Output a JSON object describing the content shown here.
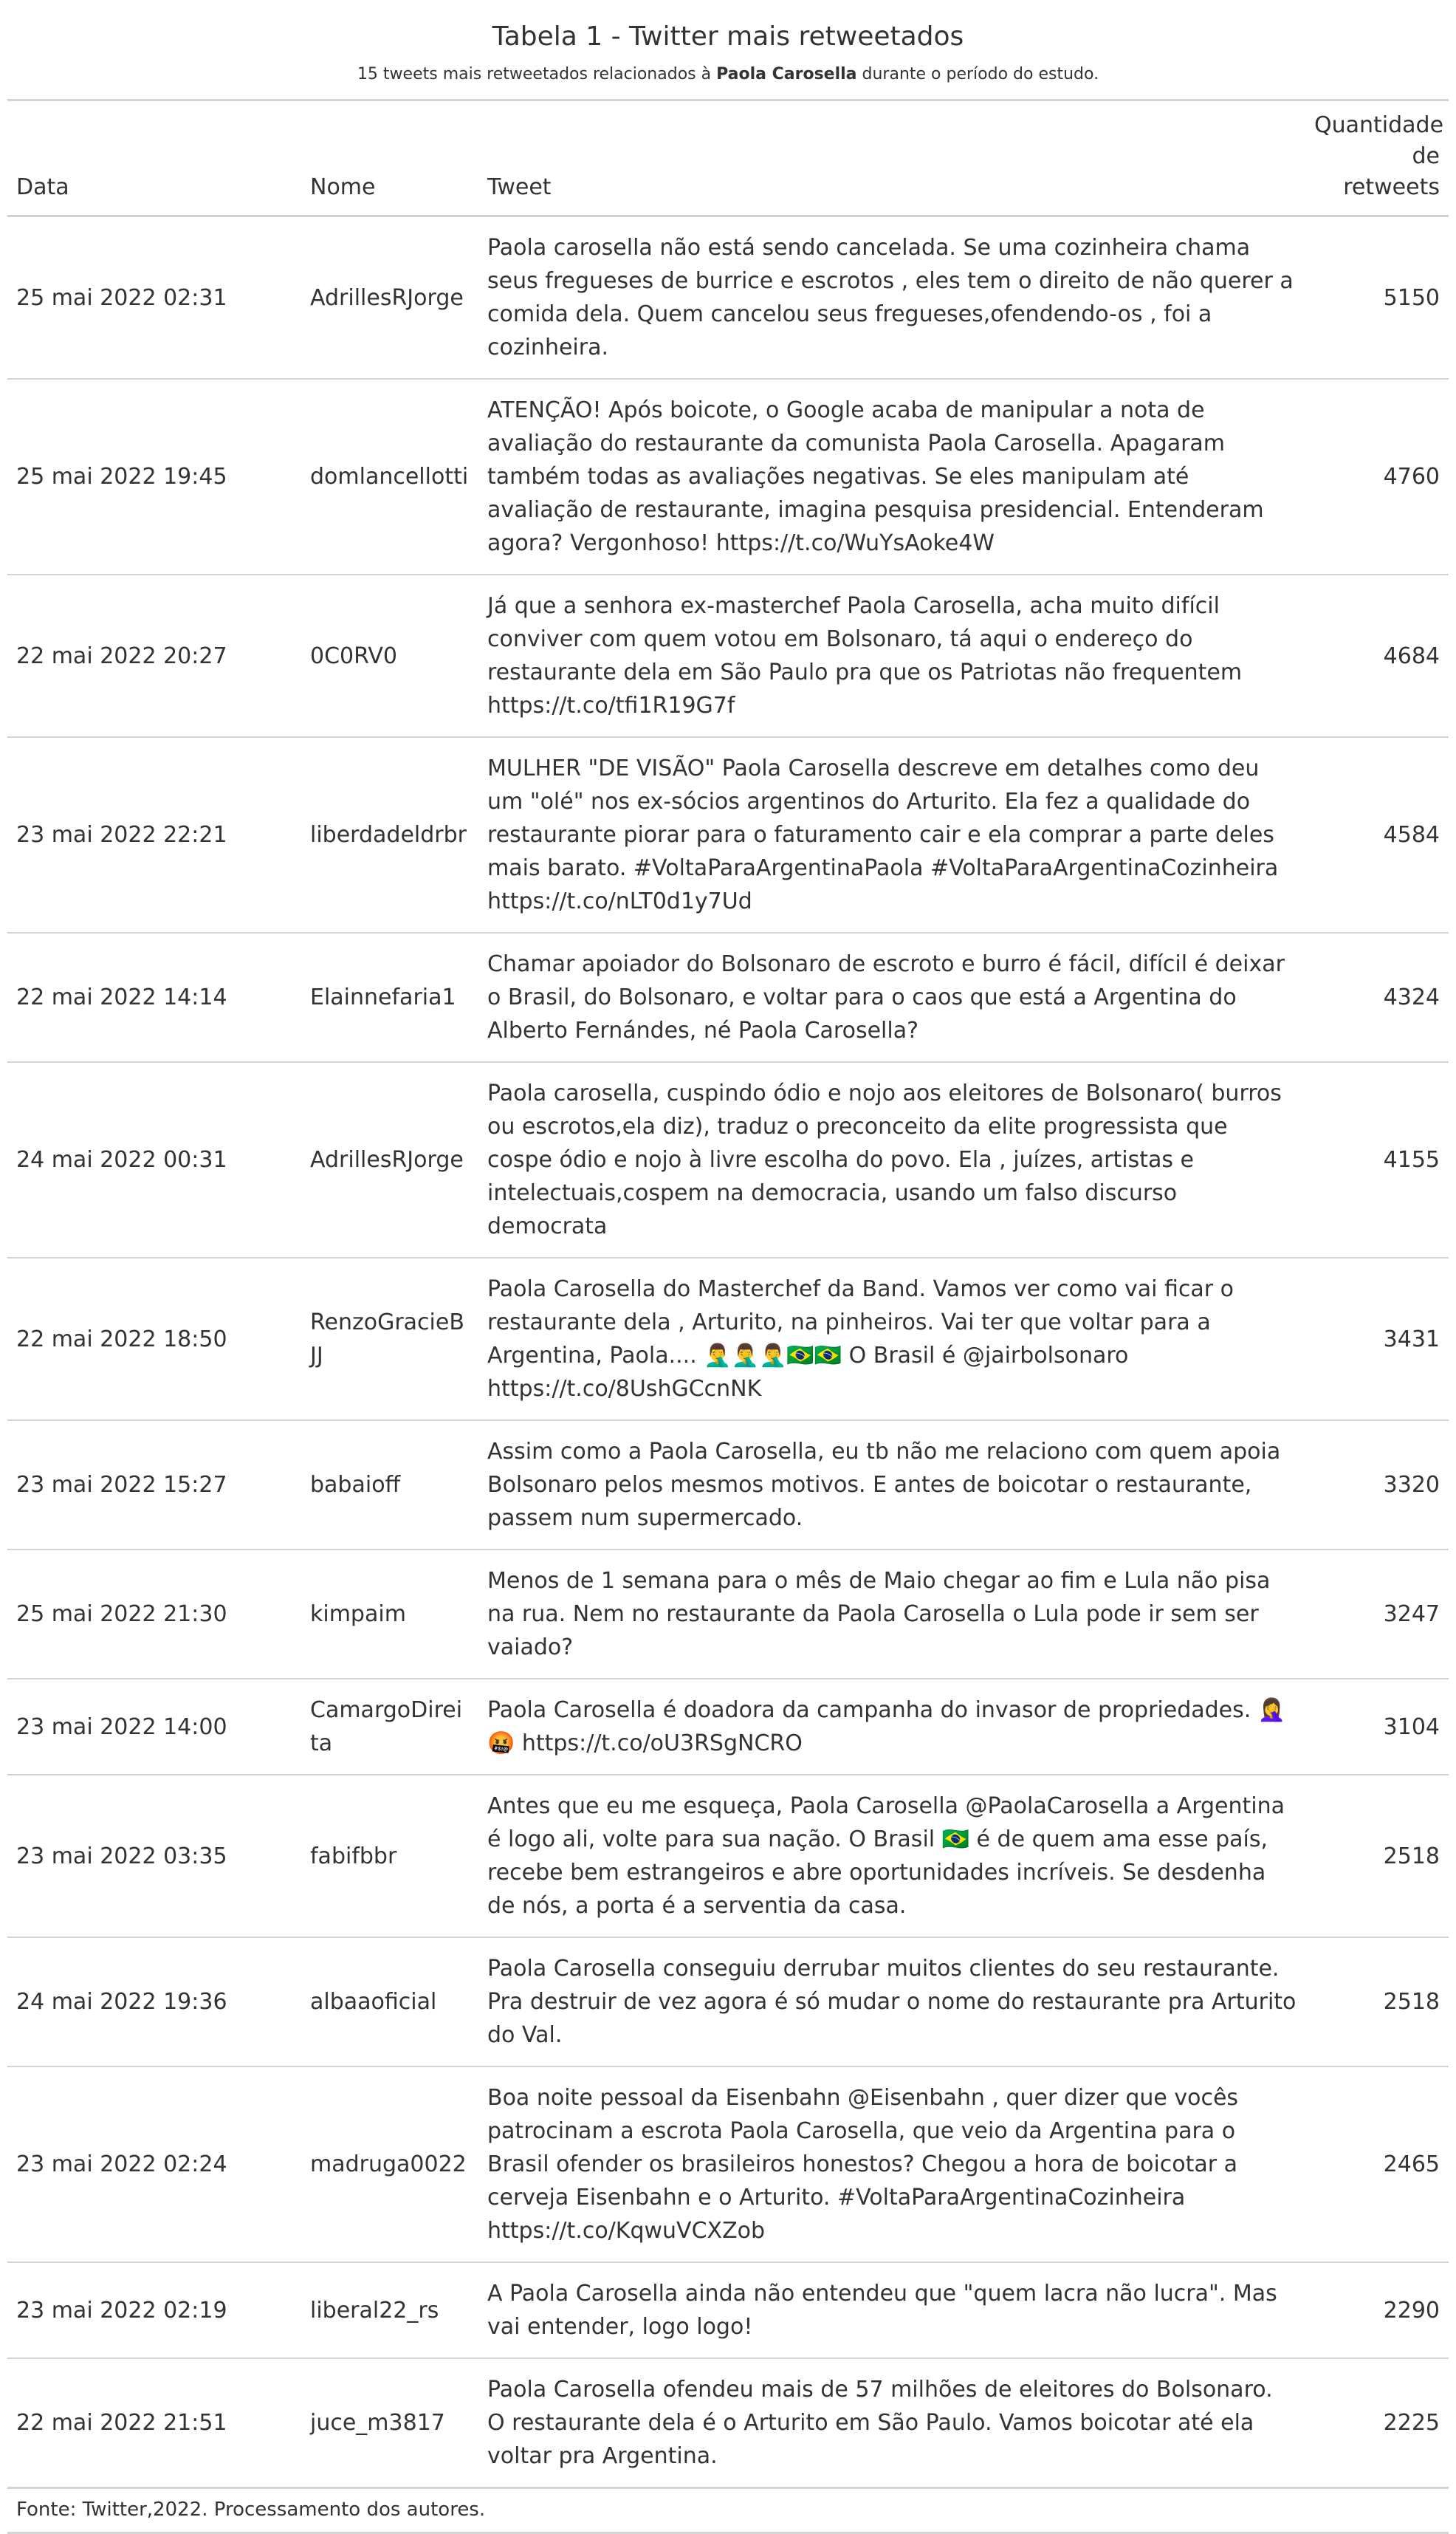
{
  "header": {
    "title": "Tabela 1 - Twitter mais retweetados",
    "subtitle_prefix": "15 tweets mais retweetados relacionados à ",
    "subtitle_bold": "Paola Carosella",
    "subtitle_suffix": " durante o período do estudo."
  },
  "table": {
    "columns": {
      "date": "Data",
      "name": "Nome",
      "tweet": "Tweet",
      "count": "Quantidade de retweets"
    },
    "rows": [
      {
        "date": "25 mai 2022 02:31",
        "name": "AdrillesRJorge",
        "tweet": "Paola carosella não está sendo cancelada. Se uma cozinheira chama seus fregueses de burrice e escrotos , eles tem o direito de não querer a comida dela. Quem cancelou seus fregueses,ofendendo-os , foi a cozinheira.",
        "count": "5150"
      },
      {
        "date": "25 mai 2022 19:45",
        "name": "domlancellotti",
        "tweet": "ATENÇÃO! Após boicote, o Google acaba de manipular a nota de avaliação do restaurante da comunista Paola Carosella. Apagaram também todas as avaliações negativas. Se eles manipulam até avaliação de restaurante, imagina pesquisa presidencial. Entenderam agora? Vergonhoso! https://t.co/WuYsAoke4W",
        "count": "4760"
      },
      {
        "date": "22 mai 2022 20:27",
        "name": "0C0RV0",
        "tweet": "Já que a senhora ex-masterchef Paola Carosella, acha muito difícil conviver com quem votou em Bolsonaro, tá aqui o endereço do restaurante dela em São Paulo pra que os Patriotas não frequentem https://t.co/tfi1R19G7f",
        "count": "4684"
      },
      {
        "date": "23 mai 2022 22:21",
        "name": "liberdadeldrbr",
        "tweet": "MULHER \"DE VISÃO\" Paola Carosella descreve em detalhes como deu um \"olé\" nos ex-sócios argentinos do Arturito. Ela fez a qualidade do restaurante piorar para o faturamento cair e ela comprar a parte deles mais barato. #VoltaParaArgentinaPaola #VoltaParaArgentinaCozinheira https://t.co/nLT0d1y7Ud",
        "count": "4584"
      },
      {
        "date": "22 mai 2022 14:14",
        "name": "Elainnefaria1",
        "tweet": "Chamar apoiador do Bolsonaro de escroto e burro é fácil, difícil é deixar o Brasil, do Bolsonaro, e voltar para o caos que está a Argentina do Alberto Fernándes, né Paola Carosella?",
        "count": "4324"
      },
      {
        "date": "24 mai 2022 00:31",
        "name": "AdrillesRJorge",
        "tweet": "Paola carosella, cuspindo ódio e nojo aos eleitores de Bolsonaro( burros ou escrotos,ela diz), traduz o preconceito da elite progressista que cospe ódio e nojo à livre escolha do povo. Ela , juízes, artistas e intelectuais,cospem na democracia, usando um falso discurso democrata",
        "count": "4155"
      },
      {
        "date": "22 mai 2022 18:50",
        "name": "RenzoGracieBJJ",
        "tweet": "Paola Carosella do Masterchef da Band. Vamos ver como vai ficar o restaurante dela , Arturito, na pinheiros. Vai ter que voltar para a Argentina, Paola.... 🤦‍♂️🤦‍♂️🤦‍♂️🇧🇷🇧🇷 O Brasil é @jairbolsonaro https://t.co/8UshGCcnNK",
        "count": "3431"
      },
      {
        "date": "23 mai 2022 15:27",
        "name": "babaioff",
        "tweet": "Assim como a Paola Carosella, eu tb não me relaciono com quem apoia Bolsonaro pelos mesmos motivos. E antes de boicotar o restaurante, passem num supermercado.",
        "count": "3320"
      },
      {
        "date": "25 mai 2022 21:30",
        "name": "kimpaim",
        "tweet": "Menos de 1 semana para o mês de Maio chegar ao fim e Lula não pisa na rua. Nem no restaurante da Paola Carosella o Lula pode ir sem ser vaiado?",
        "count": "3247"
      },
      {
        "date": "23 mai 2022 14:00",
        "name": "CamargoDireita",
        "tweet": "Paola Carosella é doadora da campanha do invasor de propriedades. 🤦‍♀️🤬 https://t.co/oU3RSgNCRO",
        "count": "3104"
      },
      {
        "date": "23 mai 2022 03:35",
        "name": "fabifbbr",
        "tweet": "Antes que eu me esqueça, Paola Carosella @PaolaCarosella a Argentina é logo ali, volte para sua nação. O Brasil 🇧🇷 é de quem ama esse país, recebe bem estrangeiros e abre oportunidades incríveis. Se desdenha de nós, a porta é a serventia da casa.",
        "count": "2518"
      },
      {
        "date": "24 mai 2022 19:36",
        "name": "albaaoficial",
        "tweet": "Paola Carosella conseguiu derrubar muitos clientes do seu restaurante. Pra destruir de vez agora é só mudar o nome do restaurante pra Arturito do Val.",
        "count": "2518"
      },
      {
        "date": "23 mai 2022 02:24",
        "name": "madruga0022",
        "tweet": "Boa noite pessoal da Eisenbahn @Eisenbahn , quer dizer que vocês patrocinam a escrota Paola Carosella, que veio da Argentina para o Brasil ofender os brasileiros honestos? Chegou a hora de boicotar a cerveja Eisenbahn e o Arturito. #VoltaParaArgentinaCozinheira https://t.co/KqwuVCXZob",
        "count": "2465"
      },
      {
        "date": "23 mai 2022 02:19",
        "name": "liberal22_rs",
        "tweet": "A Paola Carosella ainda não entendeu que \"quem lacra não lucra\". Mas vai entender, logo logo!",
        "count": "2290"
      },
      {
        "date": "22 mai 2022 21:51",
        "name": "juce_m3817",
        "tweet": "Paola Carosella ofendeu mais de 57 milhões de eleitores do Bolsonaro. O restaurante dela é o Arturito em São Paulo. Vamos boicotar até ela voltar pra Argentina.",
        "count": "2225"
      }
    ]
  },
  "footer": {
    "source": "Fonte: Twitter,2022. Processamento dos autores."
  }
}
